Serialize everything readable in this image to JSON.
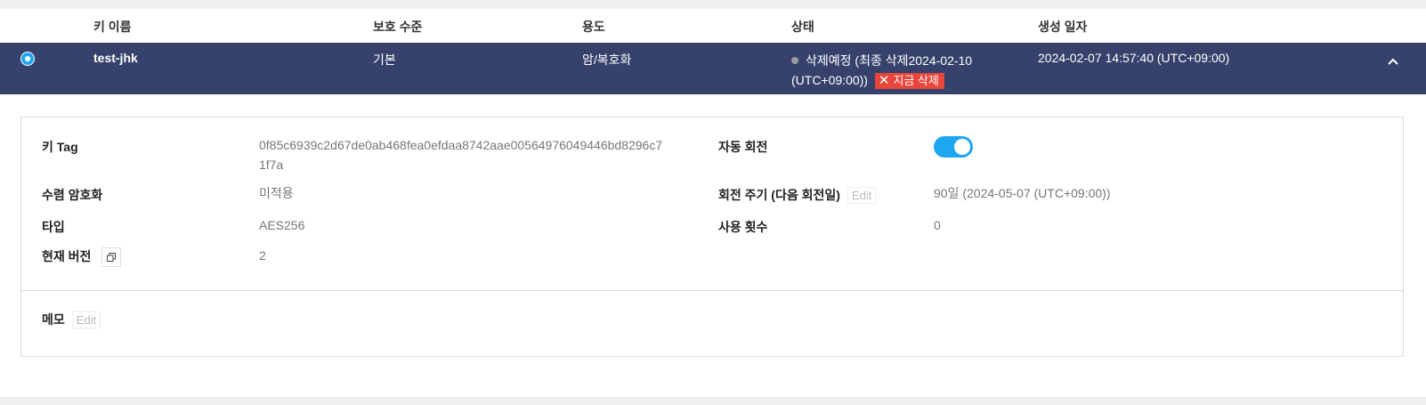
{
  "columns": {
    "key_name": "키 이름",
    "protection": "보호 수준",
    "purpose": "용도",
    "status": "상태",
    "created": "생성 일자"
  },
  "row": {
    "key_name": "test-jhk",
    "protection": "기본",
    "purpose": "암/복호화",
    "status_line1": "삭제예정 (최종 삭제2024-02-10",
    "status_line2": "(UTC+09:00))",
    "delete_now": "지금 삭제",
    "created": "2024-02-07 14:57:40 (UTC+09:00)"
  },
  "details": {
    "key_tag_label": "키 Tag",
    "key_tag_value_1": "0f85c6939c2d67de0ab468fea0efdaa8742aae00564976049446bd8296c7",
    "key_tag_value_2": "1f7a",
    "convergence_label": "수렴 암호화",
    "convergence_value": "미적용",
    "type_label": "타입",
    "type_value": "AES256",
    "version_label": "현재 버전",
    "version_value": "2",
    "auto_rotation_label": "자동 회전",
    "auto_rotation_on": true,
    "rotation_period_label": "회전 주기 (다음 회전일)",
    "rotation_period_value": "90일 (2024-05-07 (UTC+09:00))",
    "usage_count_label": "사용 횟수",
    "usage_count_value": "0",
    "memo_label": "메모",
    "edit_label": "Edit"
  },
  "colors": {
    "row_selected_bg": "#36426b",
    "accent": "#1ea7f0",
    "delete": "#e8453c"
  }
}
